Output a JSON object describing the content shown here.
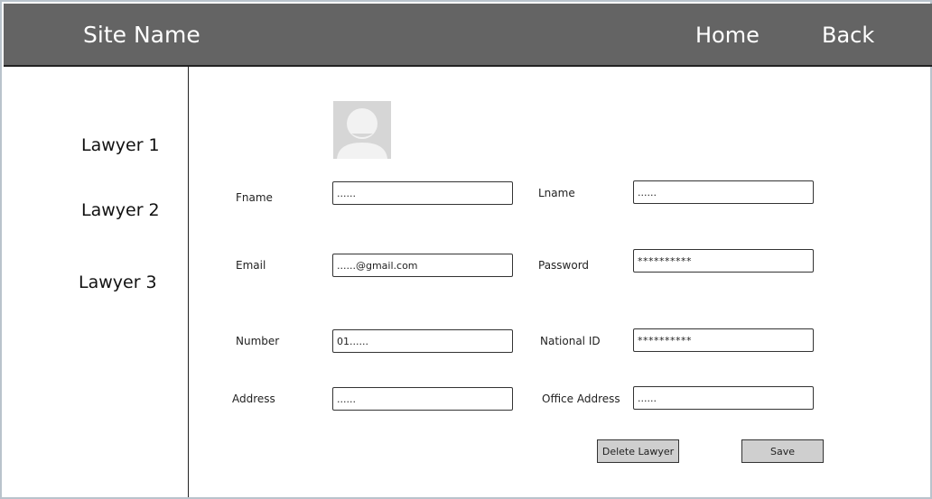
{
  "header": {
    "site_name": "Site Name",
    "nav": {
      "home": "Home",
      "back": "Back"
    }
  },
  "sidebar": {
    "items": [
      {
        "label": "Lawyer 1"
      },
      {
        "label": "Lawyer 2"
      },
      {
        "label": "Lawyer 3"
      }
    ]
  },
  "profile": {
    "avatar_icon": "user-avatar-icon"
  },
  "form": {
    "fname": {
      "label": "Fname",
      "value": "......"
    },
    "lname": {
      "label": "Lname",
      "value": "......"
    },
    "email": {
      "label": "Email",
      "value": "......@gmail.com"
    },
    "password": {
      "label": "Password",
      "value": "**********"
    },
    "number": {
      "label": "Number",
      "value": "01......"
    },
    "national_id": {
      "label": "National ID",
      "value": "**********"
    },
    "address": {
      "label": "Address",
      "value": "......"
    },
    "office_address": {
      "label": "Office Address",
      "value": "......"
    }
  },
  "actions": {
    "delete_label": "Delete Lawyer",
    "save_label": "Save"
  },
  "colors": {
    "header_bg": "#646464",
    "button_bg": "#cfcfcf",
    "avatar_bg": "#d6d6d6"
  }
}
